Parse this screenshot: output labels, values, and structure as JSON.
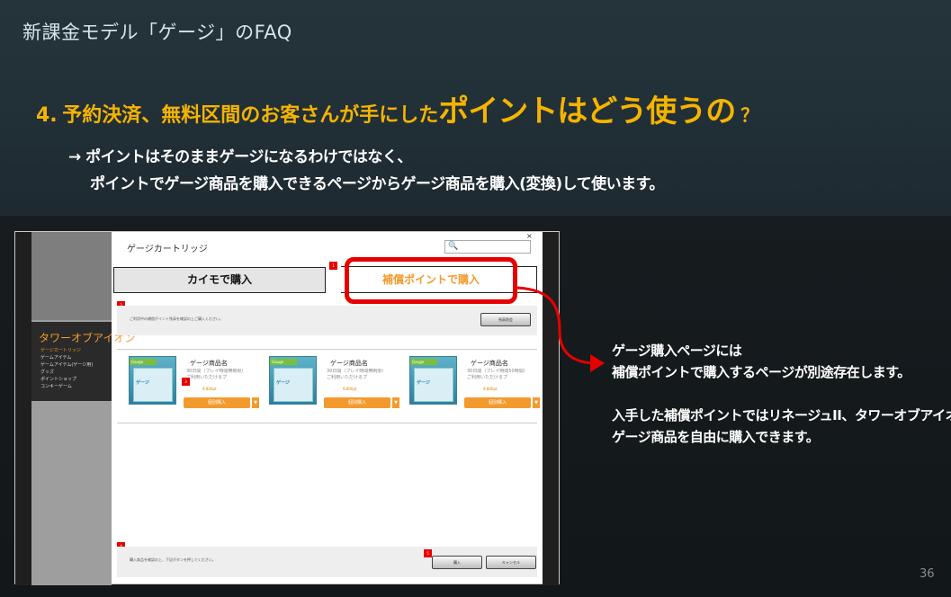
{
  "deck_title": "新課金モデル「ゲージ」のFAQ",
  "question": {
    "number": "4.",
    "part_a": "予約決済、無料区間のお客さんが手にした",
    "part_b": "ポイントはどう使うの",
    "part_c": "？"
  },
  "answer": {
    "arrow": "→",
    "line1": "ポイントはそのままゲージになるわけではなく、",
    "line2": "ポイントでゲージ商品を購入できるページからゲージ商品を購入(変換)して使います。"
  },
  "screenshot": {
    "window_title": "ゲージカートリッジ",
    "close": "×",
    "search_icon": "🔍",
    "tabs": {
      "kaimo": "カイモで購入",
      "compensation": "補償ポイントで購入"
    },
    "markers": [
      "1",
      "2",
      "3",
      "4",
      "5"
    ],
    "menu": {
      "game_title": "タワーオブアイオン",
      "items": [
        "ゲージカートリッジ",
        "ゲームアイテム",
        "ゲームアイテム(ゲージ用)",
        "グッズ",
        "ポイントショップ",
        "コンキーゲーム"
      ]
    },
    "notice_small": "ご利用中の補償ポイント残高を確認の上ご購入ください。",
    "mini_button": "残高照会",
    "products": [
      {
        "tag": "Gauge",
        "thumb_label": "ゲージ",
        "name": "ゲージ商品名",
        "desc": "30日間（プレイ時間無制限）ご利用いただけるプ",
        "price": "9,800pt",
        "buy": "個別購入",
        "caret": "▼"
      },
      {
        "tag": "Gauge",
        "thumb_label": "ゲージ",
        "name": "ゲージ商品名",
        "desc": "30日間（プレイ時間無制限）ご利用いただけるプ",
        "price": "9,800pt",
        "buy": "個別購入",
        "caret": "▼"
      },
      {
        "tag": "Gauge",
        "thumb_label": "ゲージ",
        "name": "ゲージ商品名",
        "desc": "30日間（プレイ時間50時間）ご利用いただけるプ",
        "price": "9,800pt",
        "buy": "個別購入",
        "caret": "▼"
      }
    ],
    "bottom_notice": "購入商品を確認の上、下記ボタンを押してください。",
    "bottom_buttons": [
      "購入",
      "キャンセル"
    ]
  },
  "callout": {
    "line1": "ゲージ購入ページには",
    "line2": "補償ポイントで購入するページが別途存在します。",
    "line3": "入手した補償ポイントではリネージュII、タワーオブアイオン",
    "line4": "ゲージ商品を自由に購入できます。"
  },
  "page_number": "36",
  "colors": {
    "accent_yellow": "#f5b400",
    "highlight_red": "#e60000",
    "orange": "#f29a2e"
  }
}
